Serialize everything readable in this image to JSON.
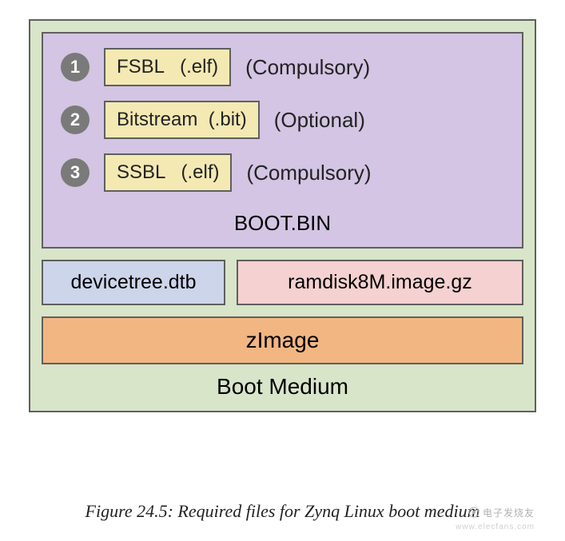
{
  "diagram": {
    "outer_label": "Boot  Medium",
    "bootbin": {
      "label": "BOOT.BIN",
      "items": [
        {
          "num": "1",
          "file": "FSBL   (.elf)",
          "note": "(Compulsory)"
        },
        {
          "num": "2",
          "file": "Bitstream  (.bit)",
          "note": "(Optional)"
        },
        {
          "num": "3",
          "file": "SSBL   (.elf)",
          "note": "(Compulsory)"
        }
      ]
    },
    "dtb": "devicetree.dtb",
    "ramdisk": "ramdisk8M.image.gz",
    "zimage": "zImage"
  },
  "caption": "Figure 24.5:  Required files for Zynq Linux boot medium",
  "watermark": {
    "top": "电子发烧友",
    "bottom": "www.elecfans.com"
  }
}
